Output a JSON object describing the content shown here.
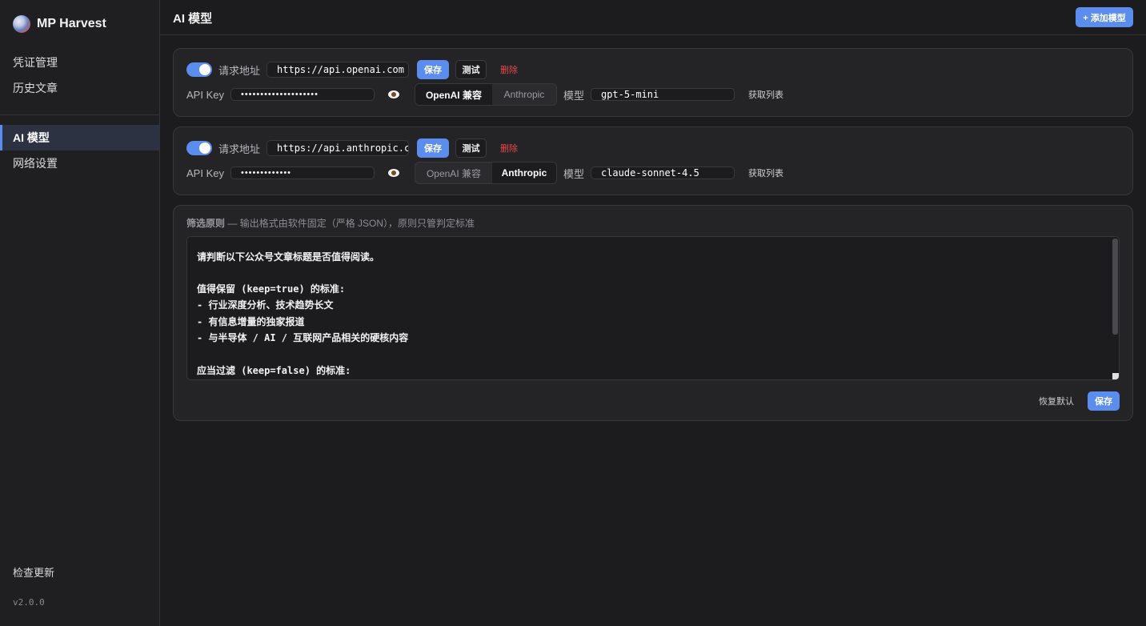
{
  "app": {
    "name": "MP Harvest",
    "version": "v2.0.0"
  },
  "sidebar": {
    "items": [
      {
        "label": "凭证管理"
      },
      {
        "label": "历史文章"
      },
      {
        "label": "AI 模型"
      },
      {
        "label": "网络设置"
      }
    ],
    "check_update": "检查更新"
  },
  "header": {
    "title": "AI 模型",
    "add_button": "+ 添加模型"
  },
  "models": [
    {
      "enabled": true,
      "url_label": "请求地址",
      "url": "https://api.openai.com",
      "save": "保存",
      "test": "测试",
      "delete": "删除",
      "key_label": "API Key",
      "key_masked": "••••••••••••••••••••",
      "providers": [
        "OpenAI 兼容",
        "Anthropic"
      ],
      "selected_provider": "OpenAI 兼容",
      "model_label": "模型",
      "model": "gpt-5-mini",
      "fetch": "获取列表"
    },
    {
      "enabled": true,
      "url_label": "请求地址",
      "url": "https://api.anthropic.com",
      "save": "保存",
      "test": "测试",
      "delete": "删除",
      "key_label": "API Key",
      "key_masked": "•••••••••••••",
      "providers": [
        "OpenAI 兼容",
        "Anthropic"
      ],
      "selected_provider": "Anthropic",
      "model_label": "模型",
      "model": "claude-sonnet-4.5",
      "fetch": "获取列表"
    }
  ],
  "rules": {
    "title": "筛选原则",
    "subtitle": "— 输出格式由软件固定（严格 JSON），原则只管判定标准",
    "lines": [
      "请判断以下公众号文章标题是否值得阅读。",
      "",
      "值得保留 (keep=true) 的标准:",
      "- 行业深度分析、技术趋势长文",
      "- 有信息增量的独家报道",
      "- 与半导体 / AI / 互联网产品相关的硬核内容",
      "",
      "应当过滤 (keep=false) 的标准:"
    ],
    "restore": "恢复默认",
    "save": "保存"
  },
  "colors": {
    "accent": "#5b8def",
    "danger": "#e5484d",
    "background": "#1c1c1e"
  }
}
